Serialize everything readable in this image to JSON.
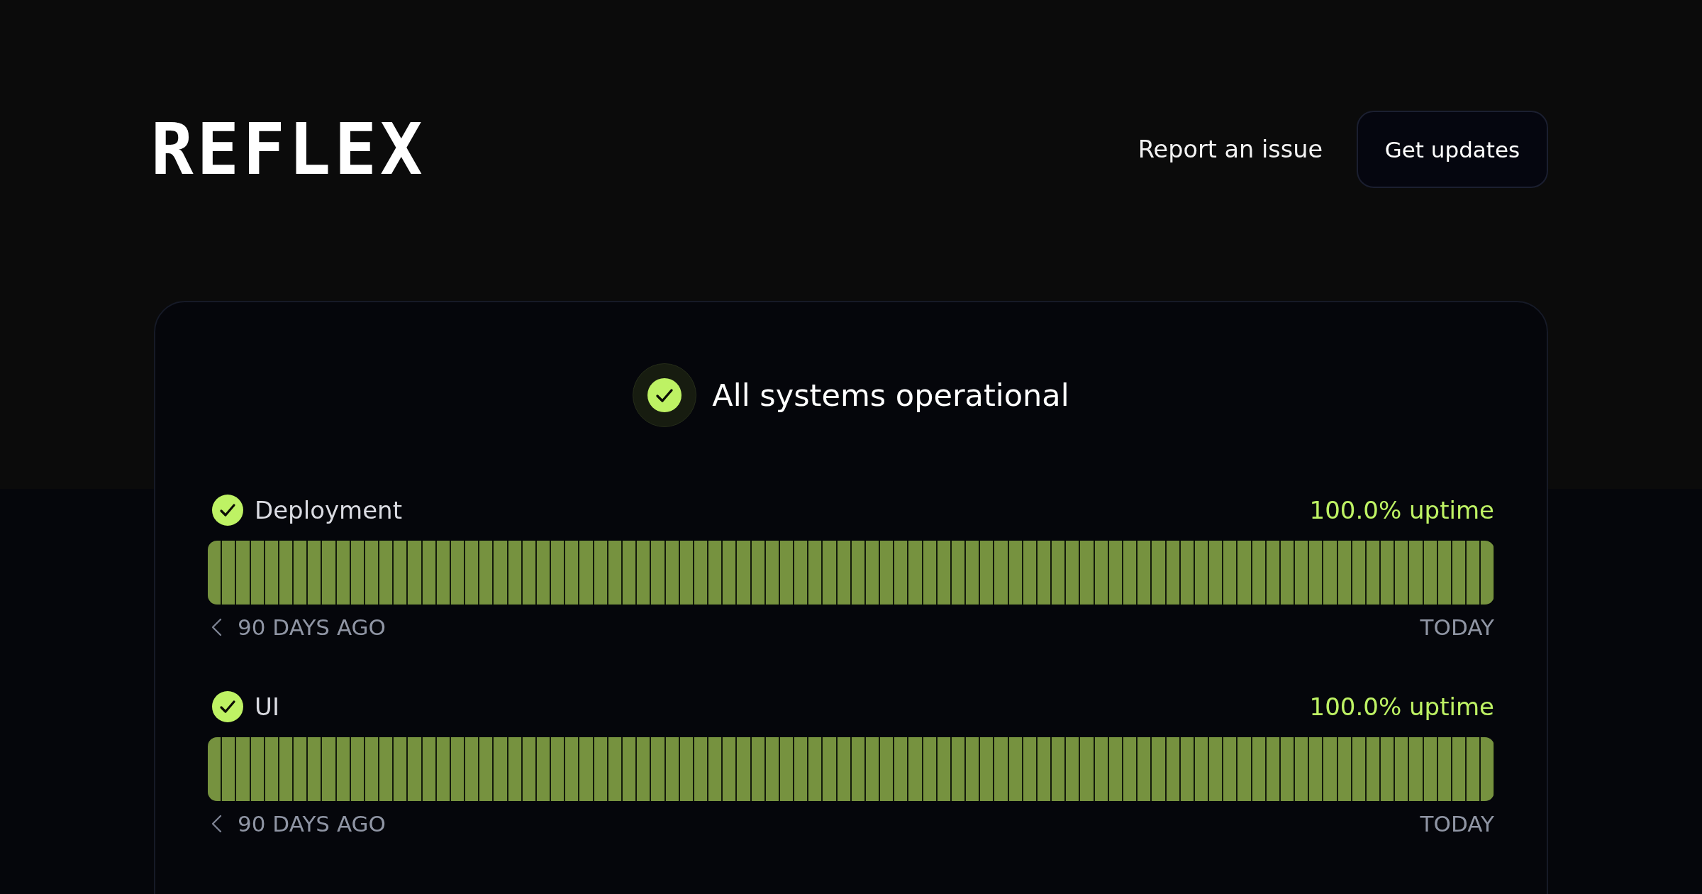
{
  "header": {
    "logo": "REFLEX",
    "actions": [
      {
        "kind": "link",
        "label": "Report an issue"
      },
      {
        "kind": "button",
        "label": "Get updates"
      }
    ]
  },
  "status": {
    "operational": true,
    "title": "All systems operational"
  },
  "services": [
    {
      "name": "Deployment",
      "operational": true,
      "uptime": "100.0% uptime",
      "days_up": [
        true,
        true,
        true,
        true,
        true,
        true,
        true,
        true,
        true,
        true,
        true,
        true,
        true,
        true,
        true,
        true,
        true,
        true,
        true,
        true,
        true,
        true,
        true,
        true,
        true,
        true,
        true,
        true,
        true,
        true,
        true,
        true,
        true,
        true,
        true,
        true,
        true,
        true,
        true,
        true,
        true,
        true,
        true,
        true,
        true,
        true,
        true,
        true,
        true,
        true,
        true,
        true,
        true,
        true,
        true,
        true,
        true,
        true,
        true,
        true,
        true,
        true,
        true,
        true,
        true,
        true,
        true,
        true,
        true,
        true,
        true,
        true,
        true,
        true,
        true,
        true,
        true,
        true,
        true,
        true,
        true,
        true,
        true,
        true,
        true,
        true,
        true,
        true,
        true,
        true
      ],
      "start_label": "90 DAYS AGO",
      "end_label": "TODAY"
    },
    {
      "name": "UI",
      "operational": true,
      "uptime": "100.0% uptime",
      "days_up": [
        true,
        true,
        true,
        true,
        true,
        true,
        true,
        true,
        true,
        true,
        true,
        true,
        true,
        true,
        true,
        true,
        true,
        true,
        true,
        true,
        true,
        true,
        true,
        true,
        true,
        true,
        true,
        true,
        true,
        true,
        true,
        true,
        true,
        true,
        true,
        true,
        true,
        true,
        true,
        true,
        true,
        true,
        true,
        true,
        true,
        true,
        true,
        true,
        true,
        true,
        true,
        true,
        true,
        true,
        true,
        true,
        true,
        true,
        true,
        true,
        true,
        true,
        true,
        true,
        true,
        true,
        true,
        true,
        true,
        true,
        true,
        true,
        true,
        true,
        true,
        true,
        true,
        true,
        true,
        true,
        true,
        true,
        true,
        true,
        true,
        true,
        true,
        true,
        true,
        true
      ],
      "start_label": "90 DAYS AGO",
      "end_label": "TODAY"
    }
  ]
}
